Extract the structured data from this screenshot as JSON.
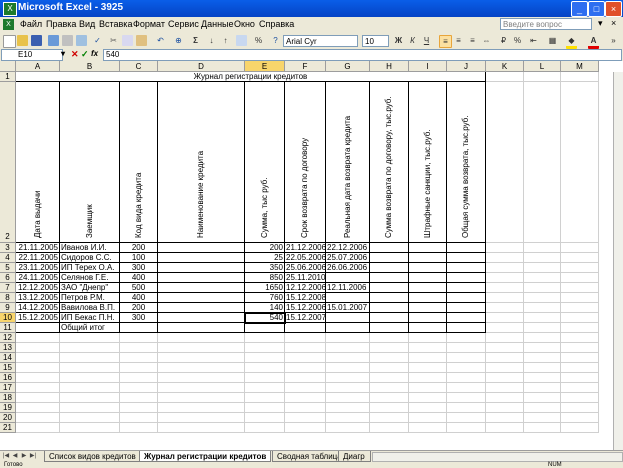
{
  "window": {
    "title": "Microsoft Excel - 3925",
    "minimize": "_",
    "maximize": "□",
    "close": "×"
  },
  "menu": {
    "items": [
      "Файл",
      "Правка",
      "Вид",
      "Вставка",
      "Формат",
      "Сервис",
      "Данные",
      "Окно",
      "Справка"
    ],
    "help_placeholder": "Введите вопрос"
  },
  "toolbar": {
    "font_name": "Arial Cyr",
    "font_size": "10",
    "bold": "Ж",
    "italic": "К",
    "underline": "Ч",
    "sigma": "Σ"
  },
  "formula_bar": {
    "name_box": "E10",
    "fx": "fx",
    "value": "540"
  },
  "columns": [
    "A",
    "B",
    "C",
    "D",
    "E",
    "F",
    "G",
    "H",
    "I",
    "J",
    "K",
    "L",
    "M"
  ],
  "selected_column": "E",
  "selected_row": "10",
  "sheet": {
    "title": "Журнал регистрации кредитов",
    "headers": [
      "Дата выдачи",
      "Заемщик",
      "Код вида кредита",
      "Наименование кредита",
      "Сумма, тыс руб.",
      "Срок возврата по договору",
      "Реальная дата возврата кредита",
      "Сумма возврата по договору, тыс.руб.",
      "Штрафные санкции, тыс.руб.",
      "Общая сумма возврата, тыс.руб."
    ],
    "rows": [
      [
        "21.11.2005",
        "Иванов И.И.",
        "200",
        "",
        "200",
        "21.12.2006",
        "22.12.2006",
        "",
        "",
        ""
      ],
      [
        "22.11.2005",
        "Сидоров С.С.",
        "100",
        "",
        "25",
        "22.05.2006",
        "25.07.2006",
        "",
        "",
        ""
      ],
      [
        "23.11.2005",
        "ИП Терех О.А.",
        "300",
        "",
        "350",
        "25.06.2006",
        "26.06.2006",
        "",
        "",
        ""
      ],
      [
        "24.11.2005",
        "Селянов Г.Е.",
        "400",
        "",
        "850",
        "25.11.2010",
        "",
        "",
        "",
        ""
      ],
      [
        "12.12.2005",
        "ЗАО \"Днепр\"",
        "500",
        "",
        "1650",
        "12.12.2006",
        "12.11.2006",
        "",
        "",
        ""
      ],
      [
        "13.12.2005",
        "Петров Р.М.",
        "400",
        "",
        "760",
        "15.12.2008",
        "",
        "",
        "",
        ""
      ],
      [
        "14.12.2005",
        "Вавилова В.П.",
        "200",
        "",
        "140",
        "15.12.2006",
        "15.01.2007",
        "",
        "",
        ""
      ],
      [
        "15.12.2005",
        "ИП Бекас П.Н.",
        "300",
        "",
        "540",
        "15.12.2007",
        "",
        "",
        "",
        ""
      ]
    ],
    "total_label": "Общий итог"
  },
  "row_numbers": [
    "1",
    "2",
    "3",
    "4",
    "5",
    "6",
    "7",
    "8",
    "9",
    "10",
    "11",
    "12",
    "13",
    "14",
    "15",
    "16",
    "17",
    "18",
    "19",
    "20",
    "21"
  ],
  "tabs": [
    {
      "label": "Список видов кредитов",
      "active": false
    },
    {
      "label": "Журнал регистрации кредитов",
      "active": true
    },
    {
      "label": "Сводная таблица",
      "active": false
    },
    {
      "label": "Диагр",
      "active": false
    }
  ],
  "status": {
    "left": "Готово",
    "right": "NUM"
  }
}
